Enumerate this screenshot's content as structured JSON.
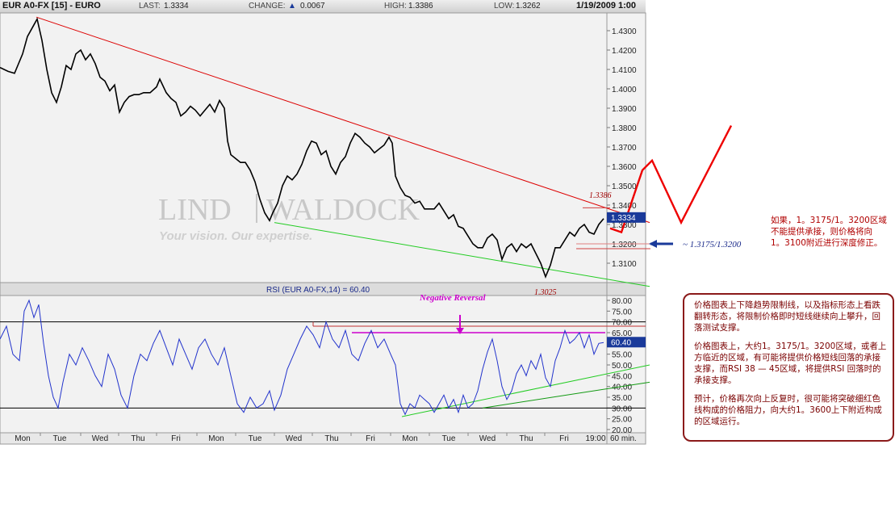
{
  "header": {
    "title": "EUR A0-FX [15] - EURO",
    "last_label": "LAST:",
    "last_value": "1.3334",
    "change_label": "CHANGE:",
    "change_value": "0.0067",
    "high_label": "HIGH:",
    "high_value": "1.3386",
    "low_label": "LOW:",
    "low_value": "1.3262",
    "datetime": "1/19/2009 1:00"
  },
  "watermark": {
    "brand_left": "LIND",
    "brand_right": "WALDOCK",
    "tagline": "Your vision. Our expertise."
  },
  "chart_data": [
    {
      "type": "line",
      "name": "price",
      "ylim": [
        1.302,
        1.44
      ],
      "yticks": [
        "1.4300",
        "1.4200",
        "1.4100",
        "1.4000",
        "1.3900",
        "1.3800",
        "1.3700",
        "1.3600",
        "1.3500",
        "1.3400",
        "1.3300",
        "1.3200",
        "1.3100"
      ],
      "ytick_values": [
        1.43,
        1.42,
        1.41,
        1.4,
        1.39,
        1.38,
        1.37,
        1.36,
        1.35,
        1.34,
        1.33,
        1.32,
        1.31
      ],
      "last_tag": "1.3334",
      "annotations": {
        "high": "1.3386",
        "low": "1.3025",
        "support": "~ 1.3175/1.3200"
      },
      "x": [
        0,
        10,
        18,
        28,
        34,
        42,
        46,
        52,
        58,
        64,
        70,
        76,
        82,
        88,
        94,
        100,
        106,
        112,
        118,
        124,
        130,
        136,
        142,
        148,
        154,
        160,
        166,
        172,
        178,
        186,
        194,
        198,
        206,
        212,
        218,
        224,
        230,
        236,
        242,
        248,
        254,
        260,
        266,
        272,
        278,
        282,
        286,
        292,
        298,
        304,
        310,
        316,
        322,
        328,
        334,
        338,
        344,
        350,
        356,
        362,
        368,
        374,
        380,
        386,
        392,
        398,
        404,
        410,
        416,
        422,
        428,
        434,
        440,
        446,
        452,
        458,
        464,
        470,
        476,
        482,
        486,
        490,
        496,
        502,
        508,
        514,
        520,
        526,
        532,
        538,
        544,
        550,
        556,
        562,
        568,
        574,
        580,
        586,
        592,
        598,
        604,
        610,
        616,
        622,
        628,
        634,
        640,
        646,
        652,
        658,
        664,
        670,
        676,
        682,
        688,
        694,
        700,
        706,
        712,
        718,
        724,
        730,
        736,
        742,
        748
      ],
      "values": [
        1.411,
        1.409,
        1.408,
        1.418,
        1.427,
        1.433,
        1.436,
        1.425,
        1.41,
        1.398,
        1.393,
        1.401,
        1.412,
        1.41,
        1.418,
        1.42,
        1.415,
        1.418,
        1.413,
        1.406,
        1.404,
        1.399,
        1.402,
        1.388,
        1.393,
        1.396,
        1.397,
        1.397,
        1.398,
        1.398,
        1.401,
        1.405,
        1.398,
        1.395,
        1.393,
        1.386,
        1.388,
        1.391,
        1.389,
        1.386,
        1.389,
        1.392,
        1.388,
        1.394,
        1.39,
        1.373,
        1.366,
        1.364,
        1.362,
        1.362,
        1.358,
        1.352,
        1.343,
        1.336,
        1.332,
        1.336,
        1.341,
        1.35,
        1.355,
        1.353,
        1.356,
        1.361,
        1.368,
        1.373,
        1.372,
        1.366,
        1.368,
        1.36,
        1.356,
        1.362,
        1.365,
        1.372,
        1.377,
        1.375,
        1.372,
        1.37,
        1.367,
        1.369,
        1.371,
        1.375,
        1.372,
        1.355,
        1.349,
        1.345,
        1.344,
        1.341,
        1.342,
        1.338,
        1.338,
        1.338,
        1.341,
        1.337,
        1.333,
        1.335,
        1.329,
        1.328,
        1.324,
        1.32,
        1.318,
        1.318,
        1.323,
        1.325,
        1.322,
        1.312,
        1.318,
        1.32,
        1.316,
        1.32,
        1.318,
        1.32,
        1.315,
        1.31,
        1.303,
        1.309,
        1.318,
        1.318,
        1.322,
        1.326,
        1.324,
        1.328,
        1.33,
        1.326,
        1.325,
        1.33,
        1.333
      ],
      "resistance_line": [
        [
          45,
          1.437
        ],
        [
          805,
          1.331
        ]
      ],
      "support_line": [
        [
          340,
          1.331
        ],
        [
          805,
          1.298
        ]
      ],
      "projection": [
        [
          756,
          1.328
        ],
        [
          770,
          1.326
        ],
        [
          796,
          1.358
        ],
        [
          808,
          1.363
        ],
        [
          844,
          1.331
        ],
        [
          906,
          1.381
        ]
      ],
      "high_marker": [
        [
          722,
          1.333
        ],
        [
          756,
          1.333
        ]
      ],
      "support_zone": [
        [
          714,
          1.3175
        ],
        [
          806,
          1.3175
        ],
        [
          714,
          1.32
        ],
        [
          806,
          1.32
        ]
      ]
    },
    {
      "type": "line",
      "name": "rsi",
      "title": "RSI (EUR A0-FX,14) = 60.40",
      "ylim": [
        20,
        85
      ],
      "yticks": [
        "80.00",
        "75.00",
        "70.00",
        "65.00",
        "60.00",
        "55.00",
        "50.00",
        "45.00",
        "40.00",
        "35.00",
        "30.00",
        "25.00",
        "20.00"
      ],
      "ytick_values": [
        80,
        75,
        70,
        65,
        60,
        55,
        50,
        45,
        40,
        35,
        30,
        25,
        20
      ],
      "last_tag": "60.40",
      "hlines": [
        70,
        30
      ],
      "annotation": "Negative Reversal",
      "x": [
        0,
        8,
        16,
        24,
        30,
        36,
        42,
        48,
        54,
        60,
        66,
        72,
        78,
        86,
        94,
        102,
        110,
        118,
        126,
        134,
        142,
        150,
        158,
        166,
        174,
        182,
        190,
        198,
        206,
        214,
        222,
        230,
        238,
        246,
        254,
        262,
        270,
        278,
        286,
        294,
        302,
        310,
        318,
        326,
        334,
        340,
        348,
        356,
        364,
        372,
        380,
        388,
        396,
        404,
        412,
        420,
        428,
        436,
        444,
        452,
        460,
        468,
        476,
        484,
        490,
        496,
        502,
        508,
        514,
        520,
        526,
        532,
        538,
        544,
        550,
        556,
        562,
        568,
        574,
        580,
        586,
        592,
        598,
        604,
        610,
        616,
        622,
        628,
        634,
        640,
        646,
        652,
        658,
        664,
        670,
        676,
        682,
        688,
        694,
        700,
        706,
        712,
        718,
        724,
        730,
        736,
        742,
        748
      ],
      "values": [
        62,
        68,
        55,
        52,
        75,
        80,
        72,
        78,
        60,
        45,
        35,
        30,
        42,
        55,
        50,
        58,
        52,
        45,
        40,
        55,
        48,
        36,
        30,
        45,
        55,
        52,
        60,
        66,
        58,
        50,
        62,
        55,
        48,
        58,
        62,
        55,
        50,
        58,
        45,
        32,
        28,
        35,
        30,
        32,
        38,
        29,
        36,
        48,
        55,
        62,
        68,
        64,
        58,
        70,
        62,
        58,
        66,
        55,
        52,
        60,
        66,
        58,
        62,
        55,
        50,
        32,
        27,
        32,
        30,
        36,
        34,
        32,
        28,
        32,
        36,
        30,
        34,
        28,
        36,
        30,
        32,
        38,
        48,
        56,
        62,
        52,
        40,
        34,
        38,
        46,
        50,
        45,
        52,
        48,
        55,
        44,
        40,
        52,
        58,
        66,
        60,
        62,
        65,
        58,
        64,
        55,
        60,
        60.4
      ]
    }
  ],
  "x_axis": {
    "labels": [
      "Mon",
      "Tue",
      "Wed",
      "Thu",
      "Fri",
      "Mon",
      "Tue",
      "Wed",
      "Thu",
      "Fri",
      "Mon",
      "Tue",
      "Wed",
      "Thu",
      "Fri",
      "19:00"
    ],
    "interval": "60 min."
  },
  "notes": {
    "side_note": [
      "如果，1。3175/1。3200区域",
      "不能提供承接，则价格将向",
      "1。3100附近进行深度修正。"
    ],
    "box_paragraphs": [
      "价格图表上下降趋势限制线，以及指标形态上看跌翻转形态，将限制价格即时短线继续向上攀升，回落测试支撑。",
      "价格图表上，大约1。3175/1。3200区域，或者上方临近的区域，有可能将提供价格短线回落的承接支撑，而RSI 38 — 45区域，将提供RSI 回落时的承接支撑。",
      "预计，价格再次向上反复时，很可能将突破细红色线构成的价格阻力，向大约1。3600上下附近构成的区域运行。"
    ]
  },
  "colors": {
    "price_line": "#000000",
    "rsi_line": "#2233cc",
    "resistance": "#dd0000",
    "support": "#22cc22",
    "projection": "#ee0000",
    "annotation_magenta": "#cc00cc",
    "tag_blue": "#1a3a9a"
  }
}
